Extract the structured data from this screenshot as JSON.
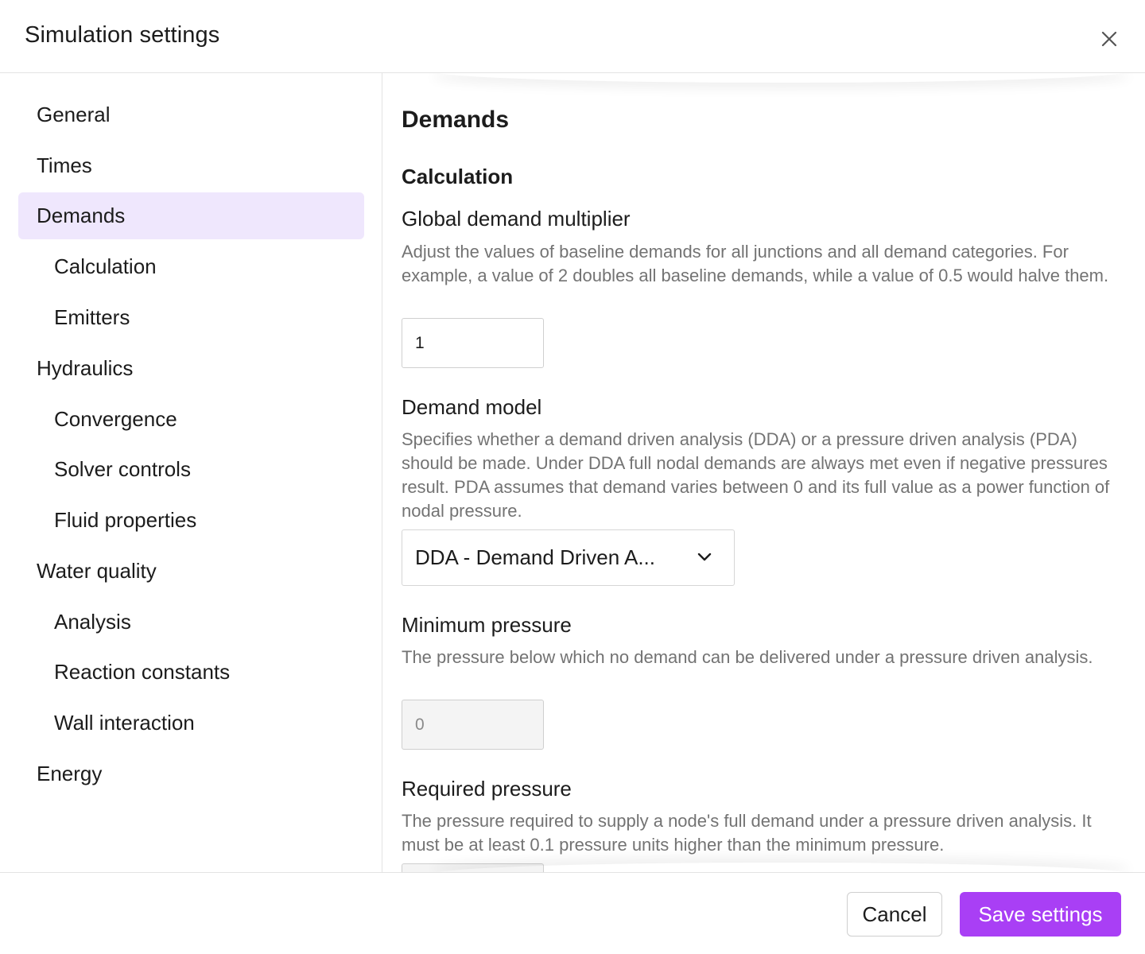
{
  "dialog": {
    "title": "Simulation settings",
    "close_icon": "close-icon"
  },
  "sidebar": {
    "items": [
      {
        "label": "General",
        "level": 0,
        "active": false
      },
      {
        "label": "Times",
        "level": 0,
        "active": false
      },
      {
        "label": "Demands",
        "level": 0,
        "active": true
      },
      {
        "label": "Calculation",
        "level": 1,
        "active": false
      },
      {
        "label": "Emitters",
        "level": 1,
        "active": false
      },
      {
        "label": "Hydraulics",
        "level": 0,
        "active": false
      },
      {
        "label": "Convergence",
        "level": 1,
        "active": false
      },
      {
        "label": "Solver controls",
        "level": 1,
        "active": false
      },
      {
        "label": "Fluid properties",
        "level": 1,
        "active": false
      },
      {
        "label": "Water quality",
        "level": 0,
        "active": false
      },
      {
        "label": "Analysis",
        "level": 1,
        "active": false
      },
      {
        "label": "Reaction constants",
        "level": 1,
        "active": false
      },
      {
        "label": "Wall interaction",
        "level": 1,
        "active": false
      },
      {
        "label": "Energy",
        "level": 0,
        "active": false
      }
    ]
  },
  "main": {
    "section_title": "Demands",
    "subsection_title": "Calculation",
    "global_multiplier": {
      "label": "Global demand multiplier",
      "description": "Adjust the values of baseline demands for all junctions and all demand categories. For example, a value of 2 doubles all baseline demands, while a value of 0.5 would halve them.",
      "value": "1"
    },
    "demand_model": {
      "label": "Demand model",
      "description": "Specifies whether a demand driven analysis (DDA) or a pressure driven analysis (PDA) should be made. Under DDA full nodal demands are always met even if negative pressures result. PDA assumes that demand varies between 0 and its full value as a power function of nodal pressure.",
      "selected": "DDA - Demand Driven A...",
      "chevron_icon": "chevron-down-icon"
    },
    "minimum_pressure": {
      "label": "Minimum pressure",
      "description": "The pressure below which no demand can be delivered under a pressure driven analysis.",
      "value": "0"
    },
    "required_pressure": {
      "label": "Required pressure",
      "description": "The pressure required to supply a node's full demand under a pressure driven analysis. It must be at least 0.1 pressure units higher than the minimum pressure."
    }
  },
  "footer": {
    "cancel_label": "Cancel",
    "save_label": "Save settings"
  },
  "colors": {
    "accent": "#a93ff5",
    "active_nav_bg": "#efe7fd",
    "muted_text": "#737373",
    "border": "#e3e3e3"
  }
}
